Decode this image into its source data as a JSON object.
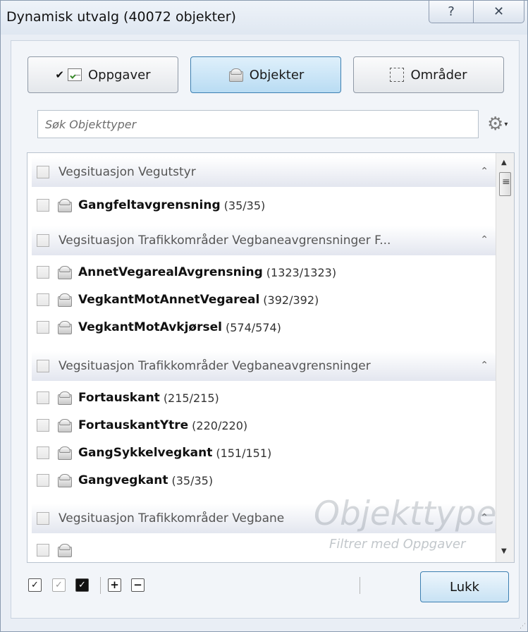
{
  "window": {
    "title": "Dynamisk utvalg (40072 objekter)",
    "help_label": "?",
    "close_label": "✕"
  },
  "tabs": [
    {
      "label": "Oppgaver",
      "checked": true,
      "icon": "task-icon"
    },
    {
      "label": "Objekter",
      "active": true,
      "icon": "object-icon"
    },
    {
      "label": "Områder",
      "icon": "area-icon"
    }
  ],
  "tab_check_glyph": "✔",
  "search": {
    "placeholder": "Søk Objekttyper"
  },
  "settings": {
    "gear_glyph": "⚙",
    "caret": "▾"
  },
  "list": {
    "groups": [
      {
        "label": "Vegsituasjon Vegutstyr"
      },
      {
        "label": "Vegsituasjon Trafikkområder Vegbaneavgrensninger F..."
      },
      {
        "label": "Vegsituasjon Trafikkområder Vegbaneavgrensninger"
      },
      {
        "label": "Vegsituasjon Trafikkområder Vegbane"
      }
    ],
    "collapse_glyph": "⌃",
    "items": [
      {
        "name": "Gangfeltavgrensning",
        "count": "(35/35)"
      },
      {
        "name": "AnnetVegarealAvgrensning",
        "count": "(1323/1323)"
      },
      {
        "name": "VegkantMotAnnetVegareal",
        "count": "(392/392)"
      },
      {
        "name": "VegkantMotAvkjørsel",
        "count": "(574/574)"
      },
      {
        "name": "Fortauskant",
        "count": "(215/215)"
      },
      {
        "name": "FortauskantYtre",
        "count": "(220/220)"
      },
      {
        "name": "GangSykkelvegkant",
        "count": "(151/151)"
      },
      {
        "name": "Gangvegkant",
        "count": "(35/35)"
      }
    ]
  },
  "watermark": {
    "title": "Objekttyper",
    "subtitle": "Filtrer med Oppgaver"
  },
  "bottom": {
    "check_all": "✓",
    "check_partial": "✓",
    "check_black": "✓",
    "expand_glyph": "+",
    "collapse_glyph": "−",
    "close_button": "Lukk"
  },
  "scrollbar": {
    "up": "▲",
    "down": "▼"
  }
}
